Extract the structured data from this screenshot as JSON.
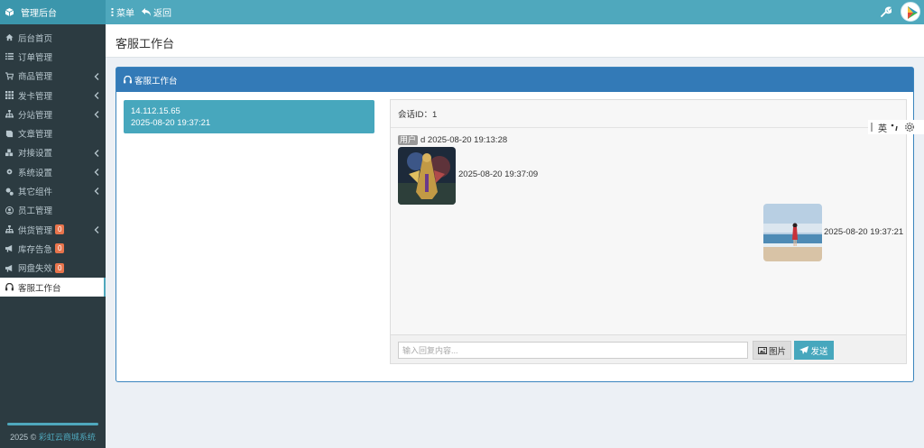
{
  "brand": {
    "title": "管理后台"
  },
  "topnav": {
    "menu_label": "菜单",
    "back_label": "返回"
  },
  "sidebar": {
    "items": [
      {
        "label": "后台首页",
        "icon": "home-icon",
        "has_chevron": false
      },
      {
        "label": "订单管理",
        "icon": "list-icon",
        "has_chevron": false
      },
      {
        "label": "商品管理",
        "icon": "cart-icon",
        "has_chevron": true
      },
      {
        "label": "发卡管理",
        "icon": "grid-icon",
        "has_chevron": true
      },
      {
        "label": "分站管理",
        "icon": "sitemap-icon",
        "has_chevron": true
      },
      {
        "label": "文章管理",
        "icon": "book-icon",
        "has_chevron": false
      },
      {
        "label": "对接设置",
        "icon": "cubes-icon",
        "has_chevron": true
      },
      {
        "label": "系统设置",
        "icon": "gear-icon",
        "has_chevron": true
      },
      {
        "label": "其它组件",
        "icon": "gears-icon",
        "has_chevron": true
      },
      {
        "label": "员工管理",
        "icon": "user-circle-icon",
        "has_chevron": false
      },
      {
        "label": "供货管理",
        "icon": "sitemap-icon",
        "has_chevron": true,
        "badge": "0"
      },
      {
        "label": "库存告急",
        "icon": "bullhorn-icon",
        "has_chevron": false,
        "badge": "0"
      },
      {
        "label": "网盘失效",
        "icon": "bullhorn-icon",
        "has_chevron": false,
        "badge": "0"
      },
      {
        "label": "客服工作台",
        "icon": "headphones-icon",
        "has_chevron": false,
        "active": true
      }
    ],
    "footer_year": "2025 ©",
    "footer_link": "彩虹云商城系统"
  },
  "page": {
    "title": "客服工作台"
  },
  "panel": {
    "title": "客服工作台"
  },
  "session": {
    "ip": "14.112.15.65",
    "time": "2025-08-20 19:37:21"
  },
  "chat": {
    "session_label": "会话ID：1",
    "user_tag": "用户",
    "user_meta": "d 2025-08-20 19:13:28",
    "left_msg_time": "2025-08-20 19:37:09",
    "right_msg_time": "2025-08-20 19:37:21",
    "input_placeholder": "输入回复内容...",
    "image_button": "图片",
    "send_button": "发送"
  },
  "ime": {
    "lang": "英"
  },
  "colors": {
    "topbar": "#4fa8bd",
    "sidebar": "#2c3b41",
    "panel_head": "#337ab7",
    "accent": "#47a7bd",
    "badge": "#e8744c"
  }
}
